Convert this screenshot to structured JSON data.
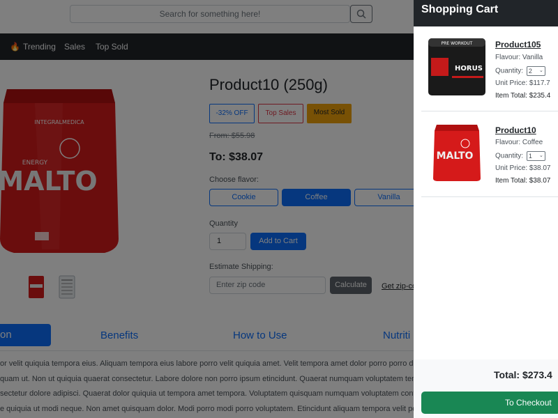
{
  "search": {
    "placeholder": "Search for something here!"
  },
  "nav": {
    "items": [
      "Trending",
      "Sales",
      "Top Sold"
    ]
  },
  "product": {
    "title": "Product10 (250g)",
    "badges": [
      "-32% OFF",
      "Top Sales",
      "Most Sold"
    ],
    "from_price": "From: $55.98",
    "to_price": "To: $38.07",
    "choose_flavor_label": "Choose flavor:",
    "flavors": [
      "Cookie",
      "Coffee",
      "Vanilla"
    ],
    "selected_flavor": "Coffee",
    "quantity_label": "Quantity",
    "quantity_value": "1",
    "add_to_cart_label": "Add to Cart",
    "shipping_label": "Estimate Shipping:",
    "zip_placeholder": "Enter zip code",
    "calculate_label": "Calculate",
    "zip_link": "Get zip-co",
    "image_brand": "INTEGRALMEDICA",
    "image_text": "MALTO",
    "image_subtext": "ENERGY"
  },
  "tabs": {
    "active": "on",
    "items": [
      "Benefits",
      "How to Use",
      "Nutriti"
    ]
  },
  "description_lines": [
    "or velit quiquia tempora eius. Aliquam tempora eius labore porro velit quiquia amet. Velit tempora amet dolor porro porro dolo",
    "quam ut. Non ut quiquia quaerat consectetur. Labore dolore non porro ipsum etincidunt. Quaerat numquam voluptatem tempo",
    "sectetur dolore adipisci. Quaerat dolor quiquia ut tempora amet tempora. Voluptatem quisquam numquam voluptatem contr",
    "e quiquia ut modi neque. Non amet quisquam dolor. Modi porro modi porro voluptatem. Etincidunt aliquam tempora velit po"
  ],
  "cart": {
    "title": "Shopping Cart",
    "items": [
      {
        "name": "Product105",
        "flavour": "Flavour: Vanilla",
        "quantity_label": "Quantity:",
        "quantity": "2",
        "unit_price": "Unit Price: $117.7",
        "item_total": "Item Total: $235.4",
        "image_text": "HORUS",
        "image_top": "PRE WORKOUT"
      },
      {
        "name": "Product10",
        "flavour": "Flavour: Coffee",
        "quantity_label": "Quantity:",
        "quantity": "1",
        "unit_price": "Unit Price: $38.07",
        "item_total": "Item Total: $38.07",
        "image_text": "MALTO"
      }
    ],
    "total": "Total: $273.4",
    "checkout_label": "To Checkout"
  },
  "colors": {
    "primary": "#0d6efd",
    "dark": "#212529",
    "success": "#198754",
    "warning": "#f0a30a",
    "danger": "#dc3545"
  }
}
